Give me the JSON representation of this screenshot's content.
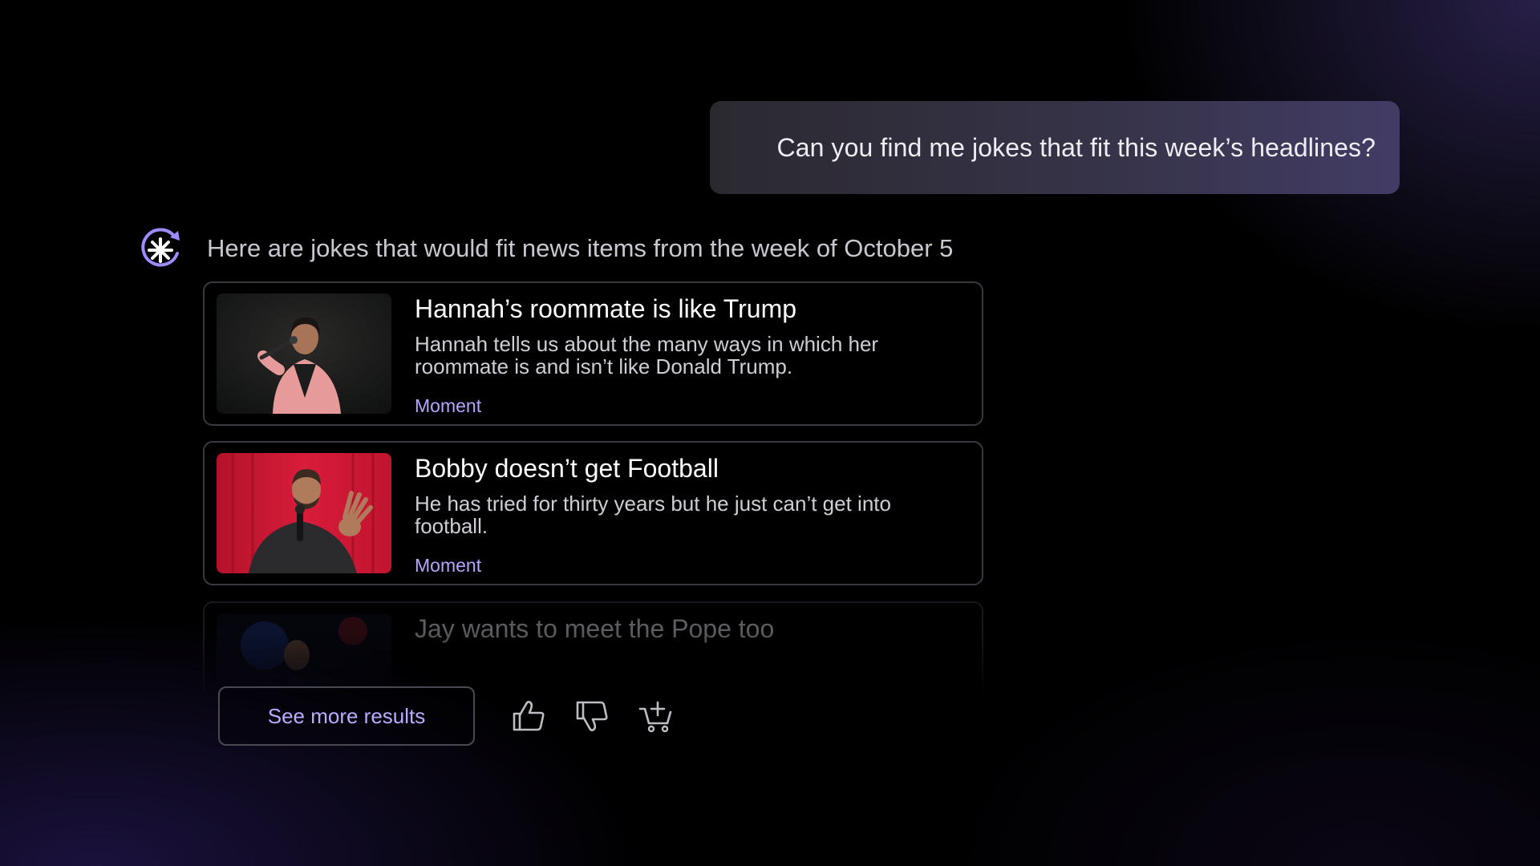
{
  "conversation": {
    "user_message": "Can you find me jokes that fit this week’s headlines?",
    "assistant_intro": "Here are jokes that would fit news items from the week of October 5"
  },
  "results": [
    {
      "title": "Hannah’s roommate is like Trump",
      "description": "Hannah tells us about the many ways in which her roommate is and isn’t like Donald Trump.",
      "tag": "Moment",
      "thumbnail": "comedian-with-microphone-pink-jacket"
    },
    {
      "title": "Bobby doesn’t get Football",
      "description": "He has tried for thirty years but he just can’t get into football.",
      "tag": "Moment",
      "thumbnail": "comedian-red-curtain"
    },
    {
      "title": "Jay wants to meet the Pope too",
      "thumbnail": "comedian-dark-stage"
    }
  ],
  "actions": {
    "see_more_label": "See more results",
    "icons": [
      "thumbs-up-icon",
      "thumbs-down-icon",
      "add-to-cart-icon"
    ]
  },
  "colors": {
    "accent": "#b3a6ff",
    "background": "#000000",
    "user_bubble": "#37344a"
  }
}
